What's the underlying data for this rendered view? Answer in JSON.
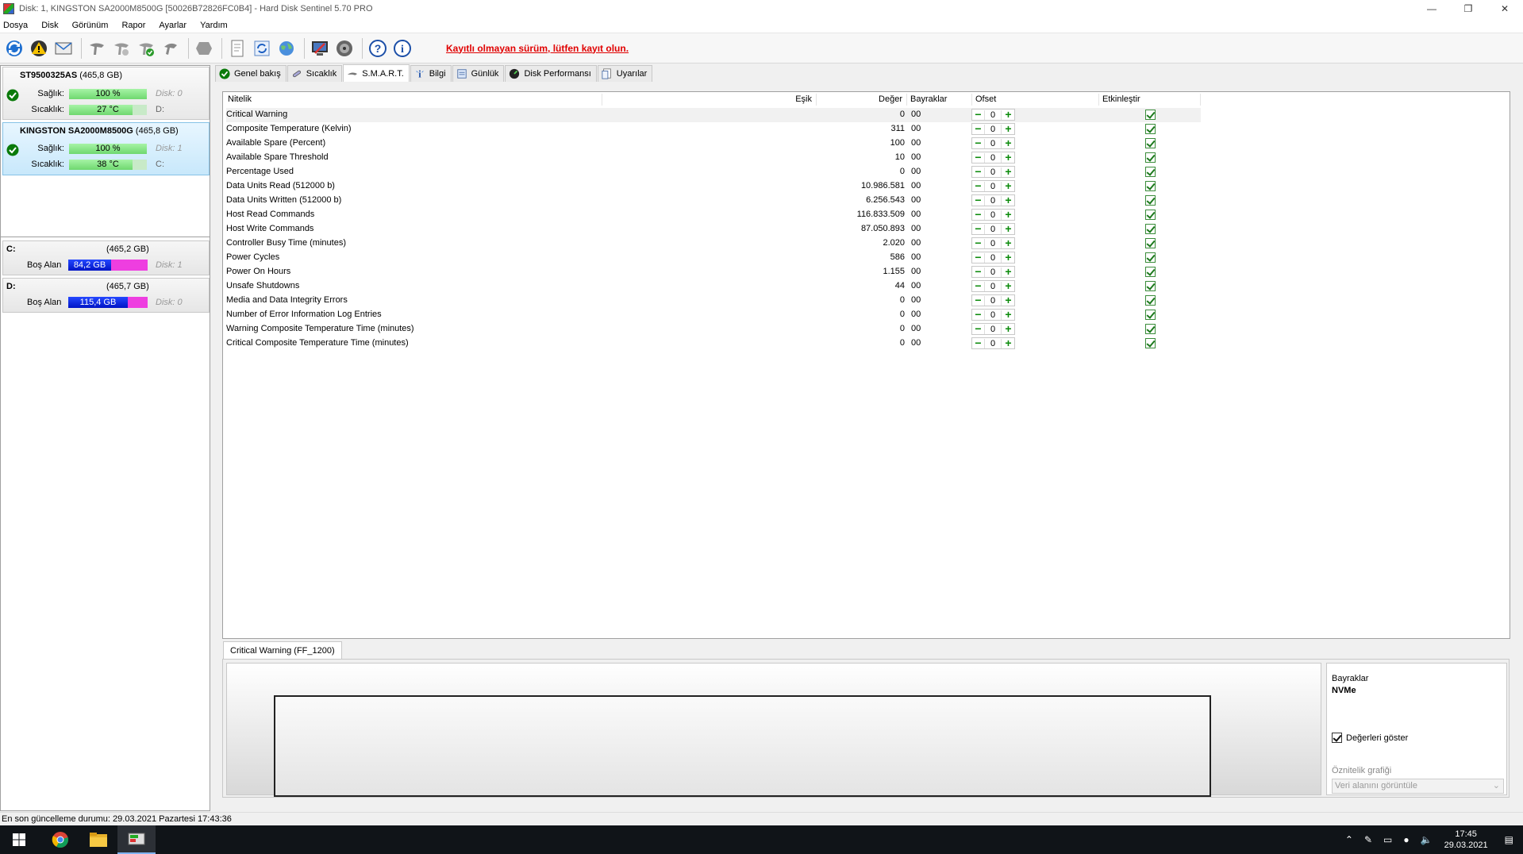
{
  "window": {
    "title": "Disk: 1, KINGSTON SA2000M8500G [50026B72826FC0B4]  -  Hard Disk Sentinel 5.70 PRO",
    "controls": [
      "—",
      "❐",
      "✕"
    ]
  },
  "menu": [
    "Dosya",
    "Disk",
    "Görünüm",
    "Rapor",
    "Ayarlar",
    "Yardım"
  ],
  "toolbar": {
    "unregistered_text": "Kayıtlı olmayan sürüm, lütfen kayıt olun."
  },
  "disks": [
    {
      "name": "ST9500325AS",
      "size": "(465,8 GB)",
      "health_label": "Sağlık:",
      "health_value": "100 %",
      "health_pct": 100,
      "disk_label": "Disk: 0",
      "temp_label": "Sıcaklık:",
      "temp_value": "27 °C",
      "drive_letter": "D:"
    },
    {
      "name": "KINGSTON SA2000M8500G",
      "size": "(465,8 GB)",
      "health_label": "Sağlık:",
      "health_value": "100 %",
      "health_pct": 100,
      "disk_label": "Disk: 1",
      "temp_label": "Sıcaklık:",
      "temp_value": "38 °C",
      "drive_letter": "C:"
    }
  ],
  "volumes": [
    {
      "letter": "C:",
      "size": "(465,2 GB)",
      "free_label": "Boş Alan",
      "free_value": "84,2 GB",
      "free_pct": 18,
      "disk_label": "Disk: 1"
    },
    {
      "letter": "D:",
      "size": "(465,7 GB)",
      "free_label": "Boş Alan",
      "free_value": "115,4 GB",
      "free_pct": 25,
      "disk_label": "Disk: 0"
    }
  ],
  "tabs": [
    {
      "label": "Genel bakış",
      "icon": "check-circle-icon"
    },
    {
      "label": "Sıcaklık",
      "icon": "thermometer-icon"
    },
    {
      "label": "S.M.A.R.T.",
      "icon": "smart-icon",
      "active": true
    },
    {
      "label": "Bilgi",
      "icon": "info-icon"
    },
    {
      "label": "Günlük",
      "icon": "log-icon"
    },
    {
      "label": "Disk Performansı",
      "icon": "gauge-icon"
    },
    {
      "label": "Uyarılar",
      "icon": "alerts-icon"
    }
  ],
  "smart_table": {
    "headers": {
      "attribute": "Nitelik",
      "threshold": "Eşik",
      "value": "Değer",
      "flags": "Bayraklar",
      "offset": "Ofset",
      "enable": "Etkinleştir"
    },
    "rows": [
      {
        "name": "Critical Warning",
        "threshold": "",
        "value": "0",
        "flags": "00",
        "offset": "0",
        "enabled": true
      },
      {
        "name": "Composite Temperature (Kelvin)",
        "threshold": "",
        "value": "311",
        "flags": "00",
        "offset": "0",
        "enabled": true
      },
      {
        "name": "Available Spare (Percent)",
        "threshold": "",
        "value": "100",
        "flags": "00",
        "offset": "0",
        "enabled": true
      },
      {
        "name": "Available Spare Threshold",
        "threshold": "",
        "value": "10",
        "flags": "00",
        "offset": "0",
        "enabled": true
      },
      {
        "name": "Percentage Used",
        "threshold": "",
        "value": "0",
        "flags": "00",
        "offset": "0",
        "enabled": true
      },
      {
        "name": "Data Units Read (512000 b)",
        "threshold": "",
        "value": "10.986.581",
        "flags": "00",
        "offset": "0",
        "enabled": true
      },
      {
        "name": "Data Units Written (512000 b)",
        "threshold": "",
        "value": "6.256.543",
        "flags": "00",
        "offset": "0",
        "enabled": true
      },
      {
        "name": "Host Read Commands",
        "threshold": "",
        "value": "116.833.509",
        "flags": "00",
        "offset": "0",
        "enabled": true
      },
      {
        "name": "Host Write Commands",
        "threshold": "",
        "value": "87.050.893",
        "flags": "00",
        "offset": "0",
        "enabled": true
      },
      {
        "name": "Controller Busy Time (minutes)",
        "threshold": "",
        "value": "2.020",
        "flags": "00",
        "offset": "0",
        "enabled": true
      },
      {
        "name": "Power Cycles",
        "threshold": "",
        "value": "586",
        "flags": "00",
        "offset": "0",
        "enabled": true
      },
      {
        "name": "Power On Hours",
        "threshold": "",
        "value": "1.155",
        "flags": "00",
        "offset": "0",
        "enabled": true
      },
      {
        "name": "Unsafe Shutdowns",
        "threshold": "",
        "value": "44",
        "flags": "00",
        "offset": "0",
        "enabled": true
      },
      {
        "name": "Media and Data Integrity Errors",
        "threshold": "",
        "value": "0",
        "flags": "00",
        "offset": "0",
        "enabled": true
      },
      {
        "name": "Number of Error Information Log Entries",
        "threshold": "",
        "value": "0",
        "flags": "00",
        "offset": "0",
        "enabled": true
      },
      {
        "name": "Warning Composite Temperature Time (minutes)",
        "threshold": "",
        "value": "0",
        "flags": "00",
        "offset": "0",
        "enabled": true
      },
      {
        "name": "Critical Composite Temperature Time (minutes)",
        "threshold": "",
        "value": "0",
        "flags": "00",
        "offset": "0",
        "enabled": true
      }
    ]
  },
  "detail": {
    "tab_label": "Critical Warning (FF_1200)",
    "flags_label": "Bayraklar",
    "flags_value": "NVMe",
    "show_values_label": "Değerleri göster",
    "show_values_checked": true,
    "graph_label": "Öznitelik grafiği",
    "graph_select_value": "Veri alanını görüntüle"
  },
  "status_bar": {
    "text": "En son güncelleme durumu: 29.03.2021 Pazartesi 17:43:36"
  },
  "taskbar": {
    "time": "17:45",
    "date": "29.03.2021"
  }
}
